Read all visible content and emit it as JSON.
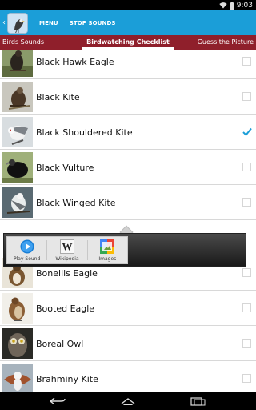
{
  "status_bar": {
    "time": "9:03"
  },
  "action_bar": {
    "app_icon": "bird-app-icon",
    "menu_label": "MENU",
    "stop_label": "STOP SOUNDS"
  },
  "tabs": [
    {
      "label": "Birds Sounds",
      "selected": false
    },
    {
      "label": "Birdwatching Checklist",
      "selected": true
    },
    {
      "label": "Guess the Picture",
      "selected": false
    }
  ],
  "list_items": [
    {
      "name": "Black Hawk Eagle",
      "checked": false
    },
    {
      "name": "Black Kite",
      "checked": false
    },
    {
      "name": "Black Shouldered Kite",
      "checked": true
    },
    {
      "name": "Black Vulture",
      "checked": false
    },
    {
      "name": "Black Winged Kite",
      "checked": false
    },
    {
      "name": "Bonellis Eagle",
      "checked": false
    },
    {
      "name": "Booted Eagle",
      "checked": false
    },
    {
      "name": "Boreal Owl",
      "checked": false
    },
    {
      "name": "Brahminy Kite",
      "checked": false
    }
  ],
  "share_popup": {
    "items": [
      {
        "label": "Play Sound",
        "icon": "play-icon"
      },
      {
        "label": "Wikipedia",
        "icon": "wikipedia-icon"
      },
      {
        "label": "Images",
        "icon": "google-images-icon"
      }
    ]
  },
  "nav_bar": {
    "buttons": [
      "back-icon",
      "home-icon",
      "recent-apps-icon"
    ]
  },
  "colors": {
    "action_bar": "#1b9ed8",
    "tab_strip": "#8f1f2b",
    "check_accent": "#1b9ed8"
  }
}
